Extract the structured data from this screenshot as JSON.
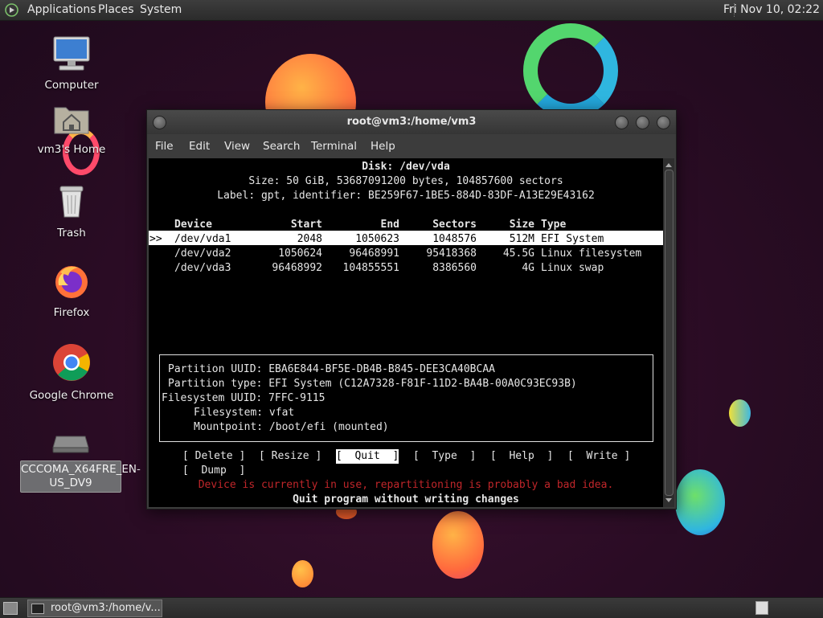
{
  "top_panel": {
    "menus": [
      "Applications",
      "Places",
      "System"
    ],
    "clock": "Fri Nov 10, 02:22"
  },
  "desktop_icons": [
    {
      "label": "Computer",
      "icon": "computer-icon"
    },
    {
      "label": "vm3's Home",
      "icon": "home-folder-icon"
    },
    {
      "label": "Trash",
      "icon": "trash-icon"
    },
    {
      "label": "Firefox",
      "icon": "firefox-icon"
    },
    {
      "label": "Google Chrome",
      "icon": "chrome-icon"
    },
    {
      "label": "CCCOMA_X64FRE_EN-US_DV9",
      "icon": "dvd-drive-icon"
    }
  ],
  "window": {
    "title": "root@vm3:/home/vm3",
    "menu": [
      "File",
      "Edit",
      "View",
      "Search",
      "Terminal",
      "Help"
    ]
  },
  "terminal": {
    "disk_line": "Disk: /dev/vda",
    "size_line": "Size: 50 GiB, 53687091200 bytes, 104857600 sectors",
    "label_line": "Label: gpt, identifier: BE259F67-1BE5-884D-83DF-A13E29E43162",
    "headers": {
      "device": "Device",
      "start": "Start",
      "end": "End",
      "sectors": "Sectors",
      "size": "Size",
      "type": "Type"
    },
    "cursor": ">>",
    "partitions": [
      {
        "device": "/dev/vda1",
        "start": "2048",
        "end": "1050623",
        "sectors": "1048576",
        "size": "512M",
        "type": "EFI System"
      },
      {
        "device": "/dev/vda2",
        "start": "1050624",
        "end": "96468991",
        "sectors": "95418368",
        "size": "45.5G",
        "type": "Linux filesystem"
      },
      {
        "device": "/dev/vda3",
        "start": "96468992",
        "end": "104855551",
        "sectors": "8386560",
        "size": "4G",
        "type": "Linux swap"
      }
    ],
    "info": {
      "partition_uuid": "Partition UUID: EBA6E844-BF5E-DB4B-B845-DEE3CA40BCAA",
      "partition_type": "Partition type: EFI System (C12A7328-F81F-11D2-BA4B-00A0C93EC93B)",
      "filesystem_uuid": "Filesystem UUID: 7FFC-9115",
      "filesystem": "Filesystem: vfat",
      "mountpoint": "Mountpoint: /boot/efi (mounted)"
    },
    "actions": {
      "delete": "[ Delete ]",
      "resize": "[ Resize ]",
      "quit": "[  Quit  ]",
      "type": "[  Type  ]",
      "help": "[  Help  ]",
      "write": "[  Write ]",
      "dump": "[  Dump  ]"
    },
    "warning": "Device is currently in use, repartitioning is probably a bad idea.",
    "hint": "Quit program without writing changes"
  },
  "taskbar": {
    "task_label": "root@vm3:/home/v..."
  }
}
